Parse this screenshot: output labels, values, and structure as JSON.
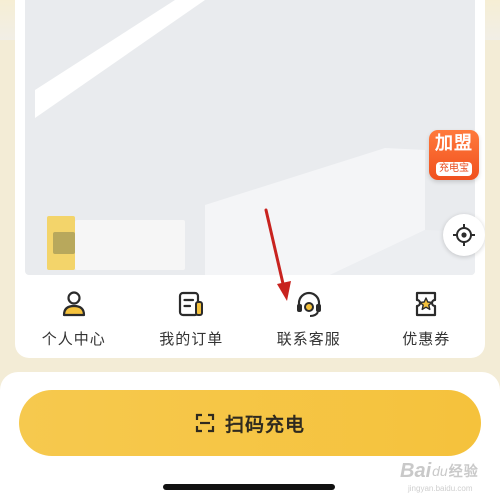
{
  "map": {
    "franchise_badge": {
      "title": "加盟",
      "subtitle": "充电宝"
    }
  },
  "quick_menu": {
    "items": [
      {
        "label": "个人中心",
        "icon": "user-icon"
      },
      {
        "label": "我的订单",
        "icon": "order-icon"
      },
      {
        "label": "联系客服",
        "icon": "headset-icon"
      },
      {
        "label": "优惠券",
        "icon": "coupon-icon"
      }
    ]
  },
  "scan_button": {
    "label": "扫码充电",
    "icon": "scan-icon"
  },
  "watermark": {
    "brand": "Bai",
    "paw": "du",
    "product": "经验",
    "url": "jingyan.baidu.com"
  },
  "colors": {
    "accent_yellow": "#f5c23c",
    "badge_orange": "#f0501e",
    "annotation_red": "#c8231f",
    "text_dark": "#333333"
  }
}
